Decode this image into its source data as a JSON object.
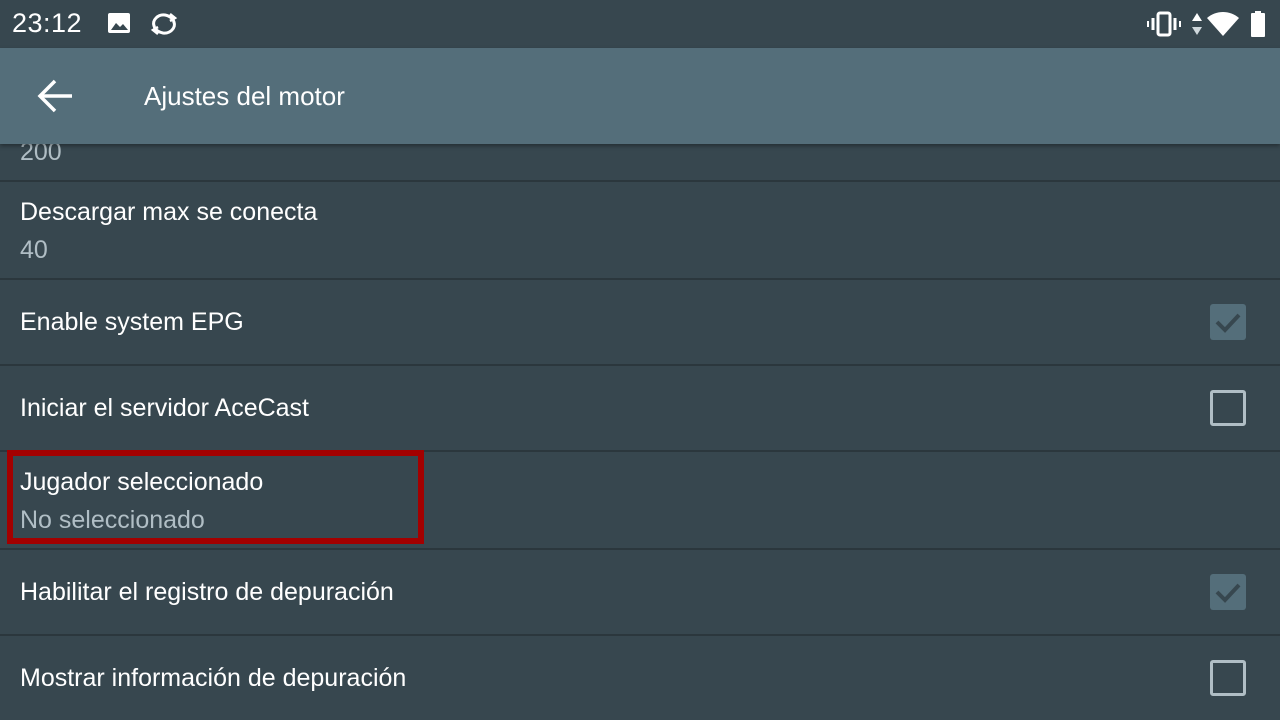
{
  "status_bar": {
    "time": "23:12",
    "left_icons": [
      "image-icon",
      "sync-icon"
    ],
    "right_icons": [
      "vibrate-icon",
      "data-arrows-icon",
      "wifi-icon",
      "battery-icon"
    ]
  },
  "app_bar": {
    "back_icon": "arrow-back-icon",
    "title": "Ajustes del motor"
  },
  "settings": {
    "cut_off_summary": "200",
    "max_connections": {
      "title": "Descargar max se conecta",
      "summary": "40"
    },
    "system_epg": {
      "title": "Enable system EPG",
      "checked": true
    },
    "acecast_server": {
      "title": "Iniciar el servidor AceCast",
      "checked": false
    },
    "selected_player": {
      "title": "Jugador seleccionado",
      "summary": "No seleccionado",
      "highlighted": true
    },
    "debug_log": {
      "title": "Habilitar el registro de depuración",
      "checked": true
    },
    "debug_info": {
      "title": "Mostrar información de depuración",
      "checked": false
    }
  },
  "colors": {
    "background": "#37474f",
    "app_bar": "#546e7a",
    "summary_text": "#b0bec5",
    "highlight": "#a30000"
  }
}
